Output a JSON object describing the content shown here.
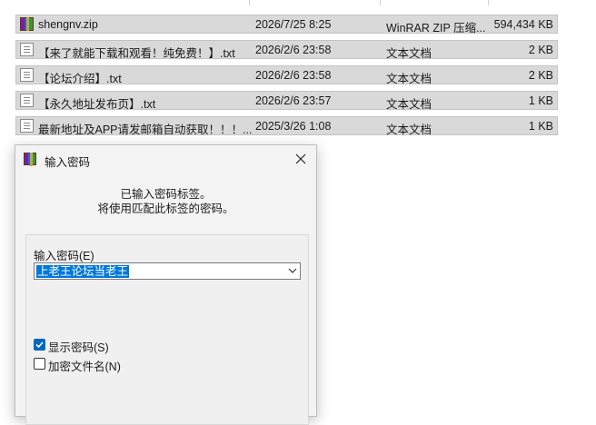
{
  "files": [
    {
      "name": "shengnv.zip",
      "date": "2026/7/25 8:25",
      "type": "WinRAR ZIP 压缩...",
      "size": "594,434 KB",
      "icon": "winrar-zip-icon"
    },
    {
      "name": "【来了就能下载和观看！纯免费！】.txt",
      "date": "2026/2/6 23:58",
      "type": "文本文档",
      "size": "2 KB",
      "icon": "text-file-icon"
    },
    {
      "name": "【论坛介绍】.txt",
      "date": "2026/2/6 23:58",
      "type": "文本文档",
      "size": "2 KB",
      "icon": "text-file-icon"
    },
    {
      "name": "【永久地址发布页】.txt",
      "date": "2026/2/6 23:57",
      "type": "文本文档",
      "size": "1 KB",
      "icon": "text-file-icon"
    },
    {
      "name": "最新地址及APP请发邮箱自动获取！！！....",
      "date": "2025/3/26 1:08",
      "type": "文本文档",
      "size": "1 KB",
      "icon": "text-file-icon"
    }
  ],
  "dialog": {
    "title": "输入密码",
    "message_line1": "已输入密码标签。",
    "message_line2": "将使用匹配此标签的密码。",
    "password_label": "输入密码(E)",
    "password_value": "上老王论坛当老王",
    "show_password_label": "显示密码(S)",
    "show_password_checked": true,
    "encrypt_filenames_label": "加密文件名(N)",
    "encrypt_filenames_checked": false
  },
  "colors": {
    "selection_blue": "#0078d7",
    "checkbox_blue": "#0067c0",
    "row_gray": "#d9d9d9"
  }
}
